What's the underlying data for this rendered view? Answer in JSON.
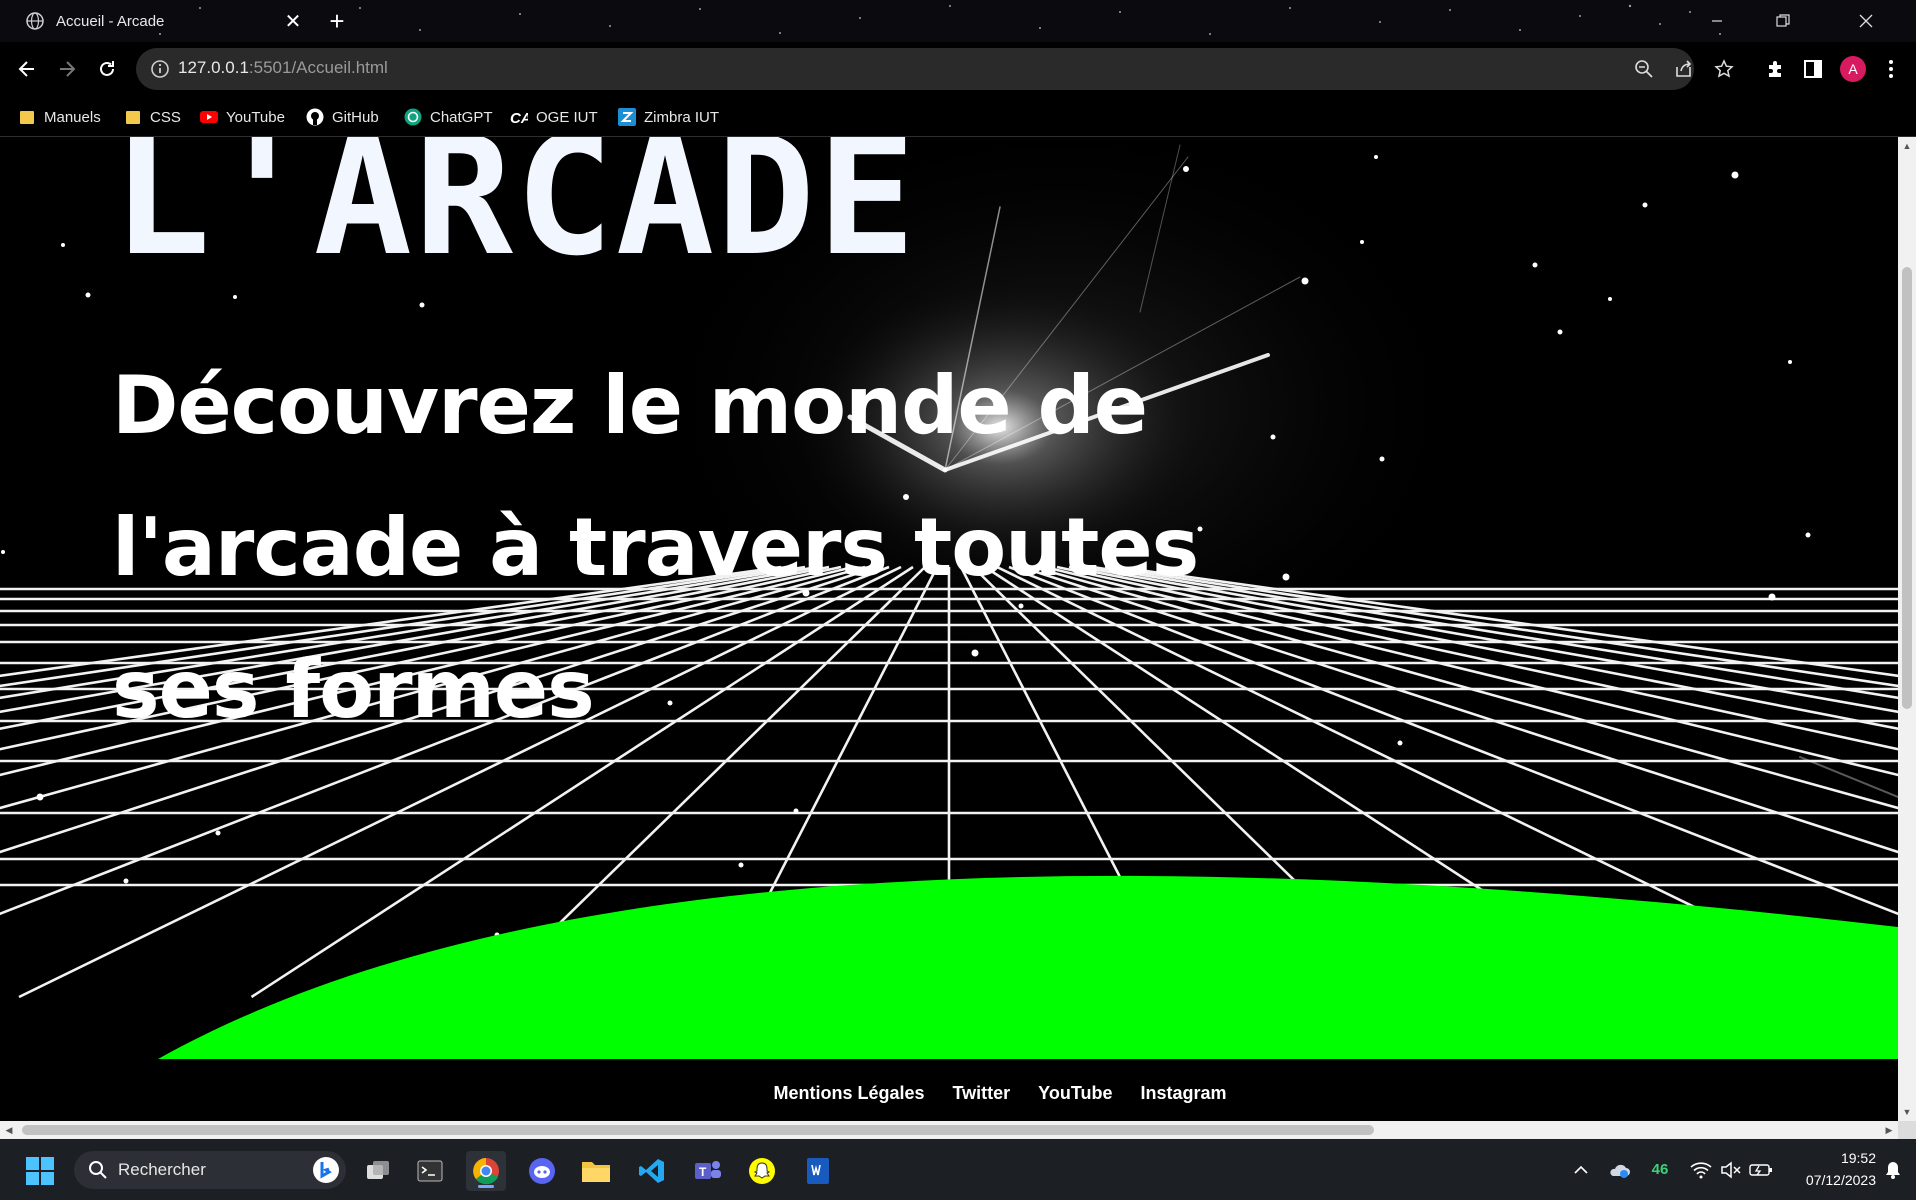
{
  "browser": {
    "tab_title": "Accueil - Arcade",
    "url_host": "127.0.0.1",
    "url_path": ":5501/Accueil.html",
    "profile_initial": "A",
    "bookmarks": [
      {
        "label": "Manuels",
        "icon": "folder-icon"
      },
      {
        "label": "CSS",
        "icon": "folder-icon"
      },
      {
        "label": "YouTube",
        "icon": "youtube-icon"
      },
      {
        "label": "GitHub",
        "icon": "github-icon"
      },
      {
        "label": "ChatGPT",
        "icon": "chatgpt-icon"
      },
      {
        "label": "OGE IUT",
        "icon": "cas-icon"
      },
      {
        "label": "Zimbra IUT",
        "icon": "zimbra-icon"
      }
    ]
  },
  "page": {
    "logo_text": "L'ARCADE",
    "headline": "Découvrez le monde de l'arcade à travers toutes ses formes",
    "footer_links": [
      "Mentions Légales",
      "Twitter",
      "YouTube",
      "Instagram"
    ],
    "accent_color": "#00ff00",
    "grid_color": "#ffffff"
  },
  "taskbar": {
    "search_placeholder": "Rechercher",
    "temperature": "46",
    "time": "19:52",
    "date": "07/12/2023",
    "apps": [
      "file-explorer-icon",
      "terminal-icon",
      "chrome-icon",
      "discord-icon",
      "folder-icon",
      "vscode-icon",
      "teams-icon",
      "snapchat-icon",
      "word-icon"
    ]
  }
}
